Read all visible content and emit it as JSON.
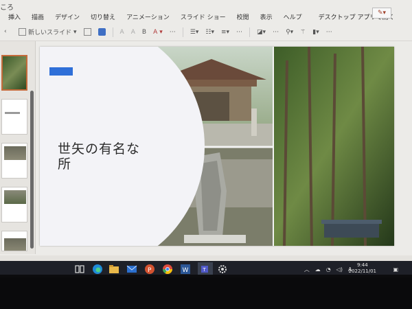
{
  "window": {
    "title_fragment": "ころ"
  },
  "ribbon": {
    "tabs": [
      "挿入",
      "描画",
      "デザイン",
      "切り替え",
      "アニメーション",
      "スライド ショー",
      "校閲",
      "表示",
      "ヘルプ"
    ],
    "open_in_desktop": "デスクトップ アプリで開く"
  },
  "toolbar": {
    "new_slide": "新しいスライド",
    "font_grow": "A",
    "font_shrink": "A",
    "bold": "B",
    "font_color": "A",
    "more": "⋯"
  },
  "slide": {
    "title": "世矢の有名な所"
  },
  "taskbar": {
    "time": "9:44",
    "date": "2022/11/01",
    "ime": "A"
  },
  "colors": {
    "accent_bar": "#2f6fd8",
    "thumb_selected": "#c56a3a",
    "taskbar": "#1e2028"
  }
}
